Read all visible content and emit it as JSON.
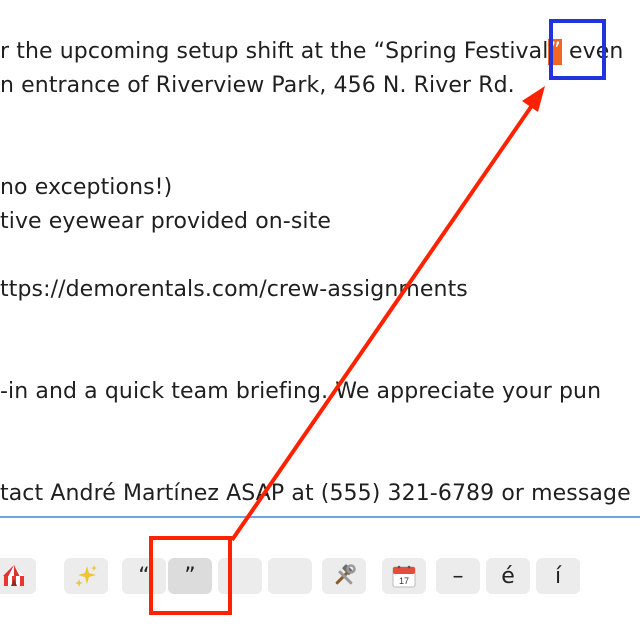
{
  "document": {
    "lines": [
      "r the upcoming setup shift at the “Spring Festival",
      "n entrance of Riverview Park, 456 N. River Rd.",
      "no exceptions!)",
      "tive eyewear provided on-site",
      "ttps://demorentals.com/crew-assignments",
      "-in and a quick team briefing. We appreciate your pun",
      "tact André Martínez ASAP at (555) 321-6789 or message"
    ],
    "selected_char": "”",
    "line1_tail": " even"
  },
  "toolbar": {
    "keys": [
      {
        "name": "circus-tent",
        "glyph": "🎪"
      },
      {
        "name": "sparkles",
        "glyph": "✨"
      },
      {
        "name": "left-double-quote",
        "glyph": "“"
      },
      {
        "name": "right-double-quote",
        "glyph": "”"
      },
      {
        "name": "blank-1",
        "glyph": ""
      },
      {
        "name": "blank-2",
        "glyph": ""
      },
      {
        "name": "hammer-wrench",
        "glyph": "🛠"
      },
      {
        "name": "calendar",
        "glyph": "17"
      },
      {
        "name": "em-dash",
        "glyph": "–"
      },
      {
        "name": "e-acute",
        "glyph": "é"
      },
      {
        "name": "i-acute",
        "glyph": "í"
      }
    ]
  },
  "colors": {
    "selection": "#f26522",
    "divider": "#6aa6e6",
    "annotation_blue": "#2233dd",
    "annotation_red": "#ff2200"
  }
}
